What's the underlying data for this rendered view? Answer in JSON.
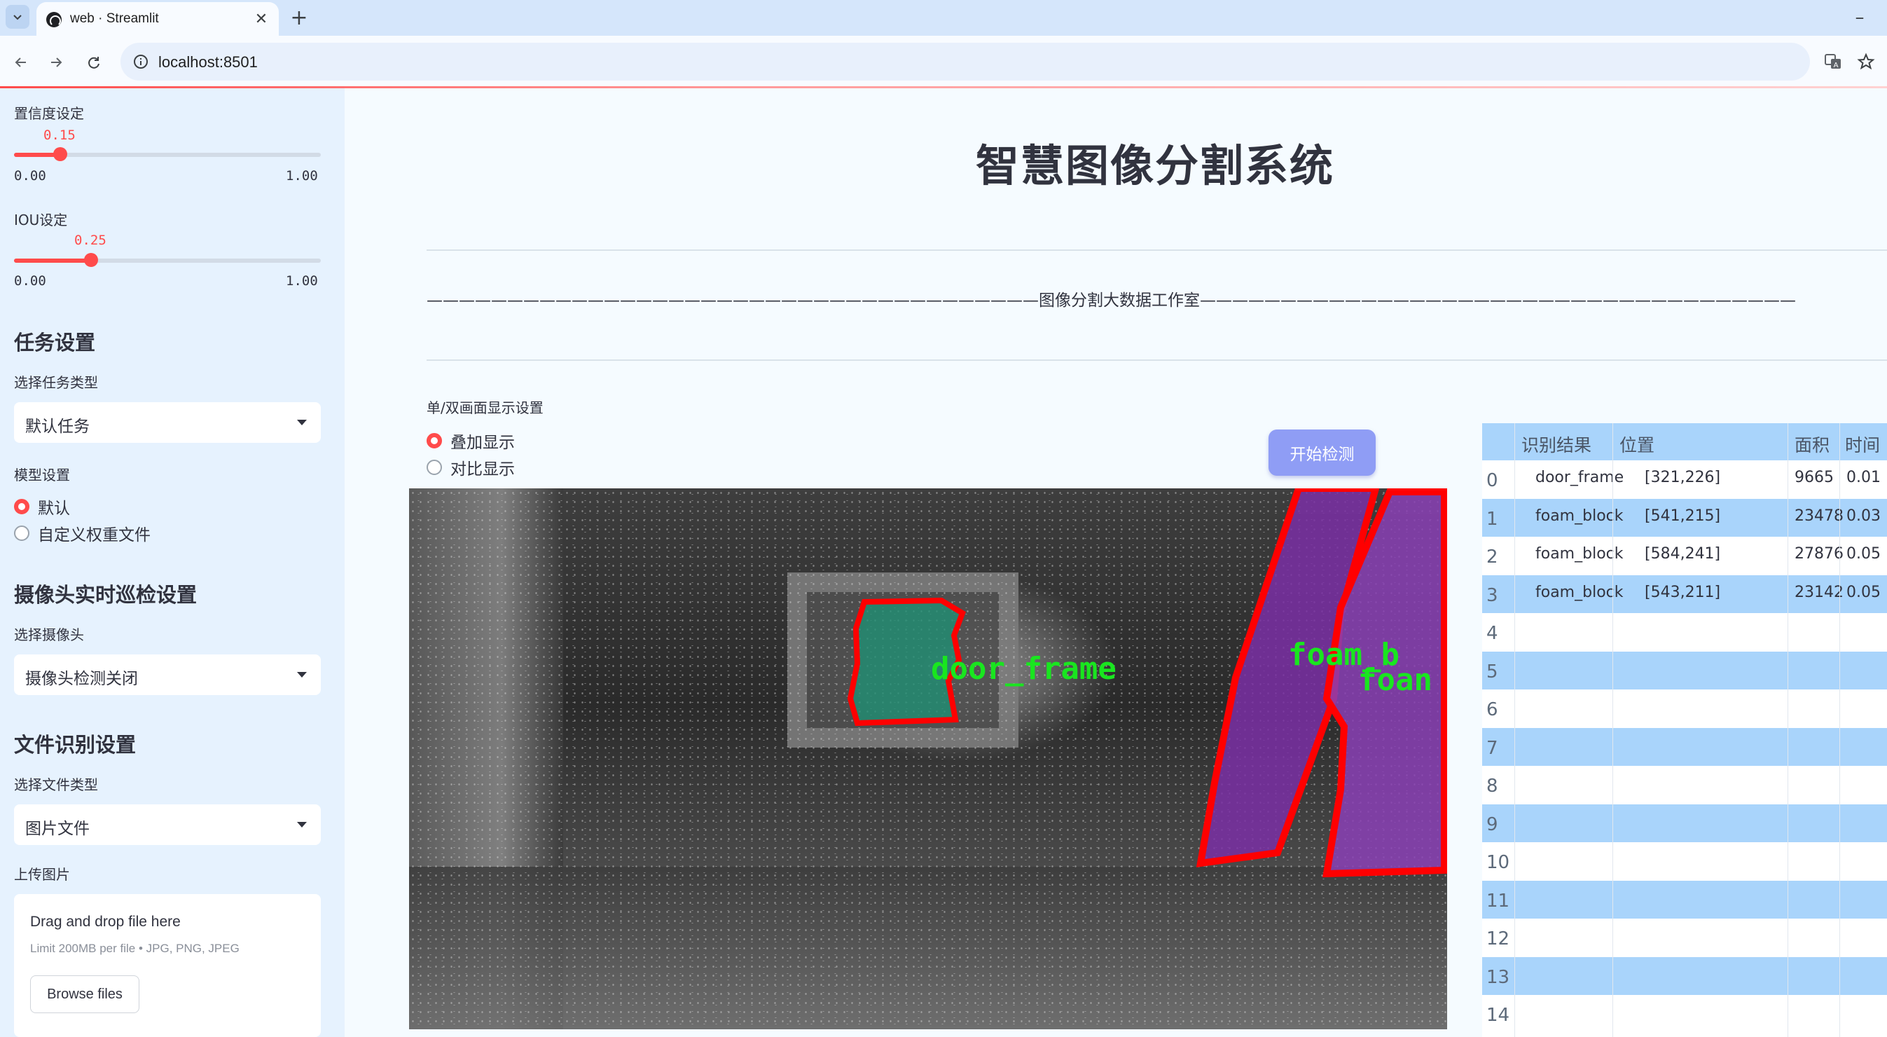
{
  "browser": {
    "tab_title": "web · Streamlit",
    "url": "localhost:8501"
  },
  "sidebar": {
    "confidence": {
      "label": "置信度设定",
      "value": "0.15",
      "min": "0.00",
      "max": "1.00",
      "fraction": 0.15
    },
    "iou": {
      "label": "IOU设定",
      "value": "0.25",
      "min": "0.00",
      "max": "1.00",
      "fraction": 0.25
    },
    "task_section": "任务设置",
    "task_type_label": "选择任务类型",
    "task_type_value": "默认任务",
    "model_label": "模型设置",
    "model_options": [
      {
        "label": "默认",
        "selected": true
      },
      {
        "label": "自定义权重文件",
        "selected": false
      }
    ],
    "camera_section": "摄像头实时巡检设置",
    "camera_label": "选择摄像头",
    "camera_value": "摄像头检测关闭",
    "file_section": "文件识别设置",
    "file_type_label": "选择文件类型",
    "file_type_value": "图片文件",
    "upload_label": "上传图片",
    "uploader": {
      "title": "Drag and drop file here",
      "limit": "Limit 200MB per file • JPG, PNG, JPEG",
      "button": "Browse files"
    }
  },
  "main": {
    "title": "智慧图像分割系统",
    "studio_line": "——————————————————————————————————————图像分割大数据工作室—————————————————————————————————————",
    "display_setting_label": "单/双画面显示设置",
    "display_options": [
      {
        "label": "叠加显示",
        "selected": true
      },
      {
        "label": "对比显示",
        "selected": false
      }
    ],
    "start_button": "开始检测",
    "detections": [
      {
        "label": "door_frame",
        "color": "#1f8f73"
      },
      {
        "label": "foam_block",
        "color": "#7a2fa5"
      },
      {
        "label": "foam_block",
        "color": "#8a3fb5"
      }
    ],
    "overlay_text": [
      "door_frame",
      "foam_b",
      "foan"
    ]
  },
  "results": {
    "headers": [
      "识别结果",
      "位置",
      "面积",
      "时间"
    ],
    "rows": [
      {
        "idx": "0",
        "label": "door_frame",
        "pos": "[321,226]",
        "area": "9665",
        "time": "0.01"
      },
      {
        "idx": "1",
        "label": "foam_block",
        "pos": "[541,215]",
        "area": "23478",
        "time": "0.03"
      },
      {
        "idx": "2",
        "label": "foam_block",
        "pos": "[584,241]",
        "area": "27876",
        "time": "0.05"
      },
      {
        "idx": "3",
        "label": "foam_block",
        "pos": "[543,211]",
        "area": "23142",
        "time": "0.05"
      },
      {
        "idx": "4"
      },
      {
        "idx": "5"
      },
      {
        "idx": "6"
      },
      {
        "idx": "7"
      },
      {
        "idx": "8"
      },
      {
        "idx": "9"
      },
      {
        "idx": "10"
      },
      {
        "idx": "11"
      },
      {
        "idx": "12"
      },
      {
        "idx": "13"
      },
      {
        "idx": "14"
      }
    ]
  },
  "colors": {
    "accent": "#ff4b4b",
    "button": "#8f9df5",
    "table_stripe": "#a9d4fb",
    "sidebar_bg": "#e6f2fe",
    "mask_outline": "#ff0000"
  }
}
